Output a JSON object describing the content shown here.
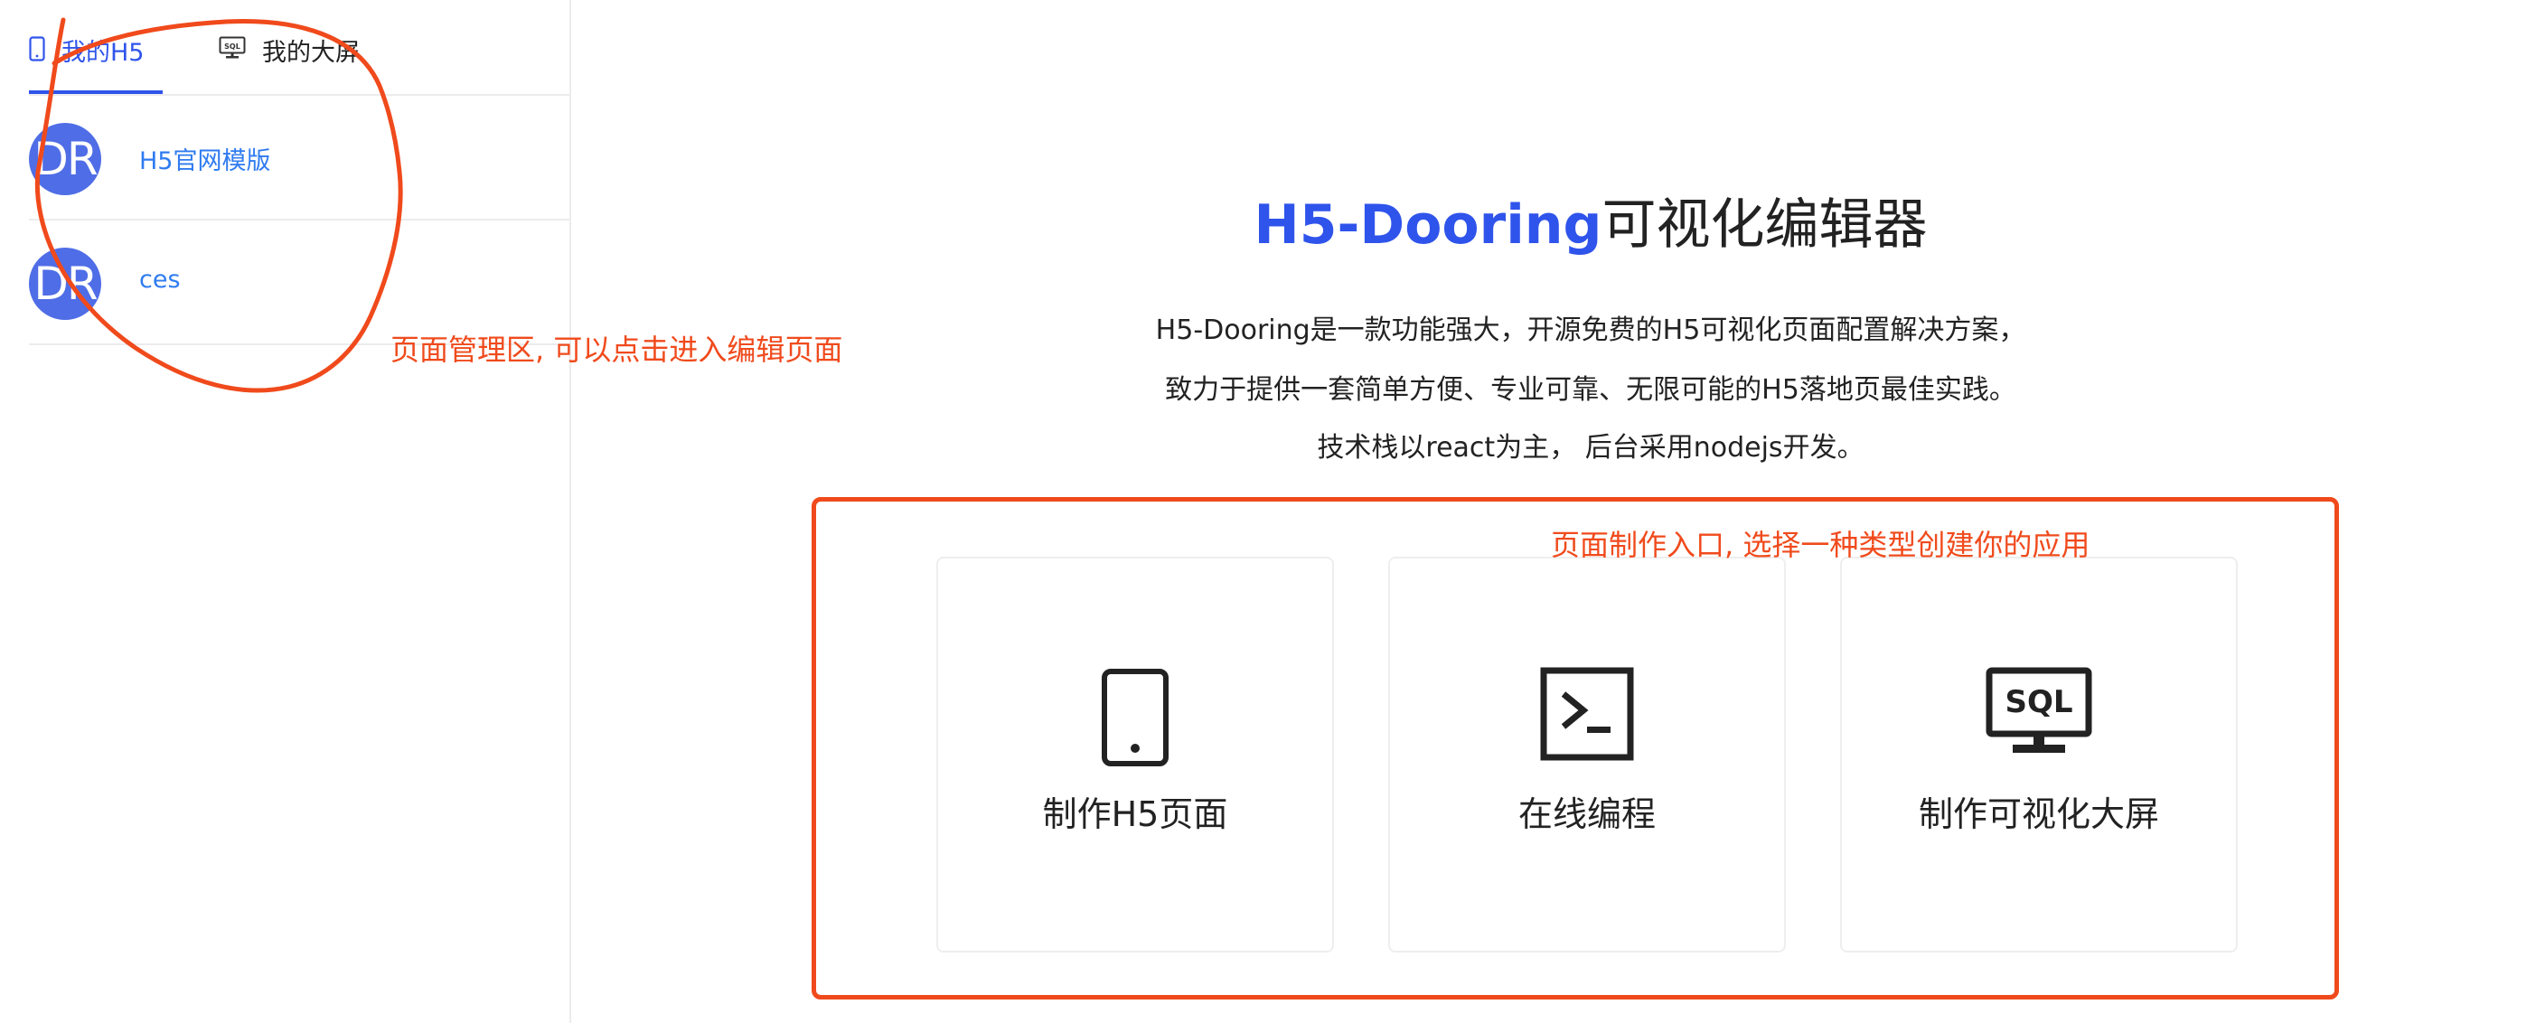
{
  "sidebar": {
    "tabs": [
      {
        "label": "我的H5",
        "icon": "mobile-icon",
        "active": true
      },
      {
        "label": "我的大屏",
        "icon": "sql-screen-icon",
        "active": false
      }
    ],
    "items": [
      {
        "avatar": "DR",
        "title": "H5官网模版"
      },
      {
        "avatar": "DR",
        "title": "ces"
      }
    ]
  },
  "main": {
    "title_brand": "H5-Dooring",
    "title_rest": "可视化编辑器",
    "description": [
      "H5-Dooring是一款功能强大，开源免费的H5可视化页面配置解决方案，",
      "致力于提供一套简单方便、专业可靠、无限可能的H5落地页最佳实践。",
      "技术栈以react为主， 后台采用nodejs开发。"
    ],
    "cards": [
      {
        "label": "制作H5页面",
        "icon": "mobile-icon"
      },
      {
        "label": "在线编程",
        "icon": "terminal-icon"
      },
      {
        "label": "制作可视化大屏",
        "icon": "sql-screen-icon",
        "icon_text": "SQL"
      }
    ]
  },
  "annotations": {
    "left_note": "页面管理区, 可以点击进入编辑页面",
    "right_note": "页面制作入口, 选择一种类型创建你的应用"
  },
  "colors": {
    "brand": "#2f54eb",
    "link": "#2f7bf0",
    "avatar_bg": "#4f6de6",
    "annotation": "#f04a1c",
    "border": "#ececec"
  }
}
